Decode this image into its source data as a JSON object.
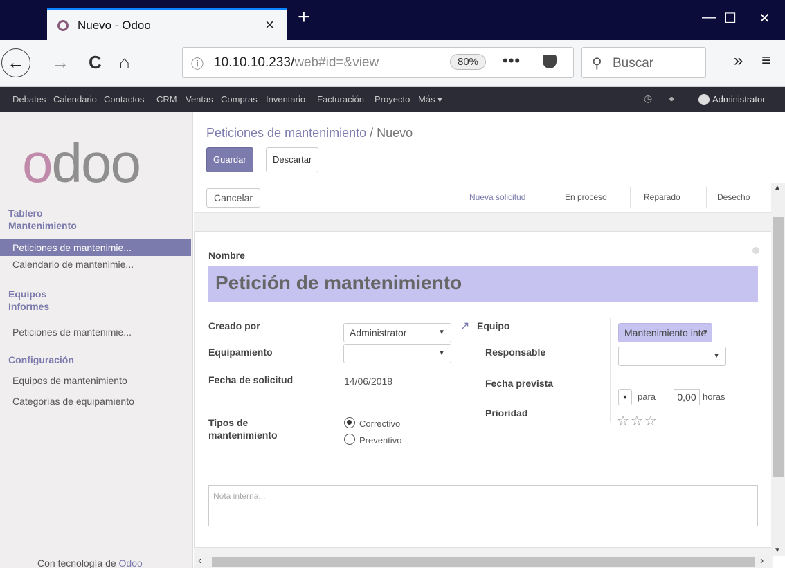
{
  "browser": {
    "tab_title": "Nuevo - Odoo",
    "tab_close": "×",
    "new_tab": "+",
    "win_min": "—",
    "win_max": "☐",
    "win_close": "✕",
    "url_host": "10.10.10.233/",
    "url_path": "web#id=&view",
    "zoom": "80%",
    "url_more": "•••",
    "search_placeholder": "Buscar",
    "overflow": "»",
    "menu": "≡",
    "back": "←",
    "forward": "→",
    "reload": "C",
    "home": "⌂",
    "info": "ⓘ",
    "search_icon": "⚲"
  },
  "odoo_menu": {
    "items": [
      "Debates",
      "Calendario",
      "Contactos",
      "CRM",
      "Ventas",
      "Compras",
      "Inventario",
      "Facturación",
      "Proyecto",
      "Más ▾"
    ],
    "user": "Administrator",
    "clock_icon": "◷",
    "chat_icon": "●"
  },
  "sidebar": {
    "logo": "odoo",
    "heading_tablero": "Tablero",
    "heading_mantenimiento": "Mantenimiento",
    "items_mantenimiento": [
      "Peticiones de mantenimie...",
      "Calendario de mantenimie..."
    ],
    "heading_equipos": "Equipos",
    "heading_informes": "Informes",
    "items_informes": [
      "Peticiones de mantenimie..."
    ],
    "heading_configuracion": "Configuración",
    "items_configuracion": [
      "Equipos de mantenimiento",
      "Categorías de equipamiento"
    ],
    "footer_prefix": "Con tecnología de ",
    "footer_brand": "Odoo"
  },
  "control": {
    "breadcrumb_parent": "Peticiones de mantenimiento",
    "breadcrumb_sep": " / ",
    "breadcrumb_current": "Nuevo",
    "save": "Guardar",
    "discard": "Descartar",
    "cancel": "Cancelar",
    "stages": [
      "Nueva solicitud",
      "En proceso",
      "Reparado",
      "Desecho"
    ],
    "active_stage": "Nueva solicitud"
  },
  "form": {
    "name_label": "Nombre",
    "name_value": "Petición de mantenimiento",
    "created_by_label": "Creado por",
    "created_by_value": "Administrator",
    "equipment_label": "Equipamiento",
    "equipment_value": "",
    "request_date_label": "Fecha de solicitud",
    "request_date_value": "14/06/2018",
    "type_label_1": "Tipos de",
    "type_label_2": "mantenimiento",
    "type_options": [
      "Correctivo",
      "Preventivo"
    ],
    "type_selected": "Correctivo",
    "team_label": "Equipo",
    "team_value": "Mantenimiento inte",
    "responsible_label": "Responsable",
    "responsible_value": "",
    "scheduled_label": "Fecha prevista",
    "scheduled_for": "para",
    "duration_value": "0,00",
    "duration_unit": "horas",
    "priority_label": "Prioridad",
    "priority_stars": "☆☆☆",
    "priority_value": 0,
    "note_placeholder": "Nota interna..."
  },
  "colors": {
    "accent": "#7c7bad",
    "highlight": "#c6c3f0",
    "menu_bg": "#2c2c36",
    "tabbar_bg": "#0c0c3a"
  }
}
